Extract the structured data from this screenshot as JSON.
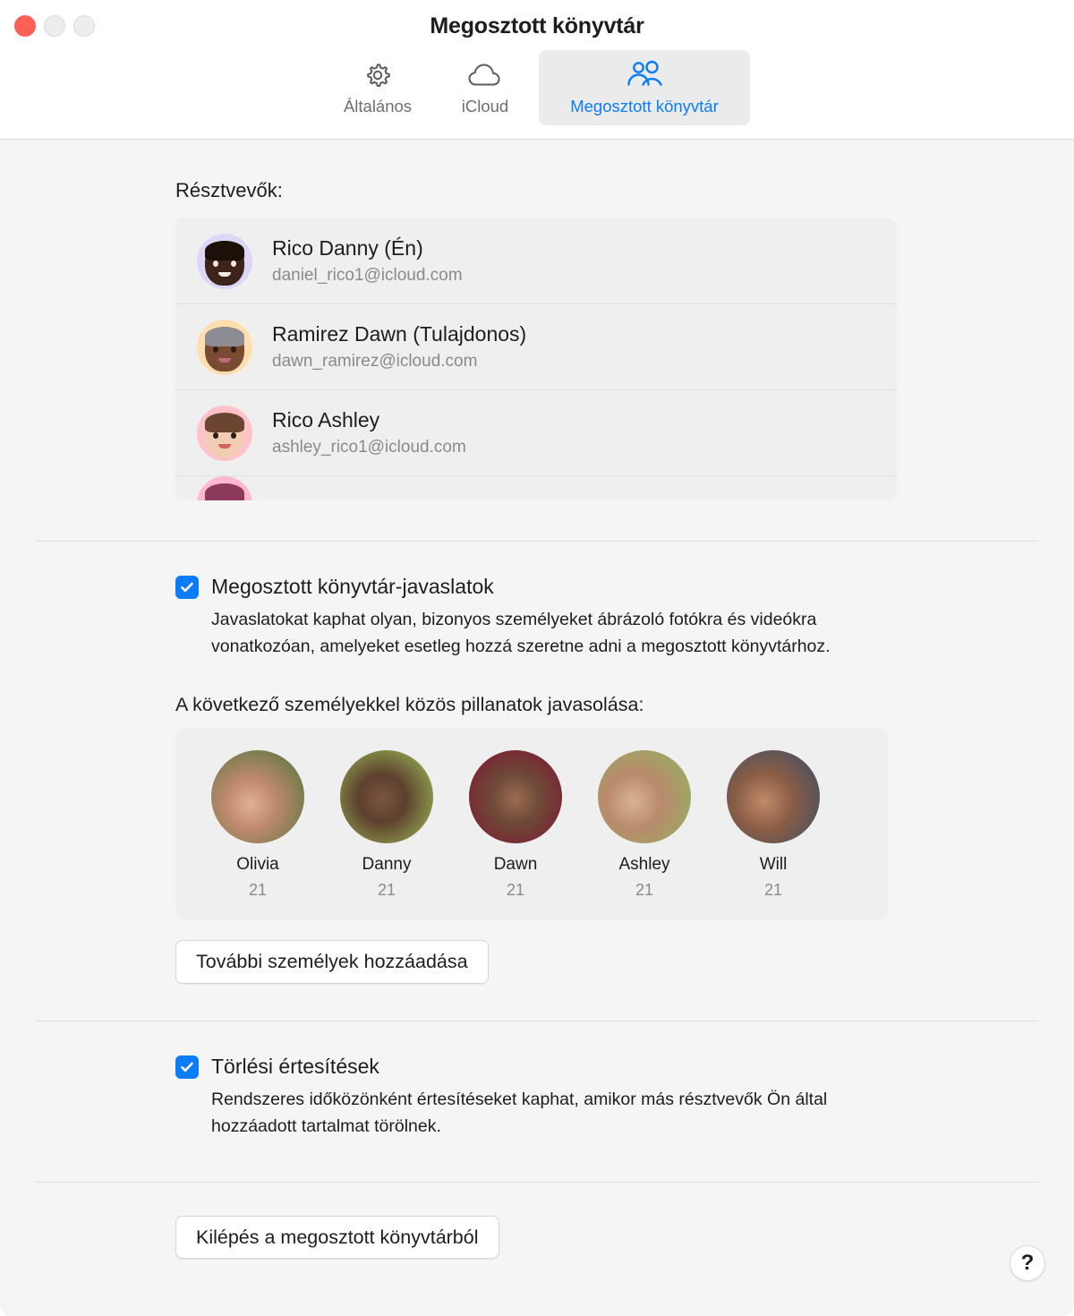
{
  "window": {
    "title": "Megosztott könyvtár",
    "traffic_lights": [
      "close",
      "minimize",
      "zoom"
    ]
  },
  "tabs": [
    {
      "id": "general",
      "label": "Általános",
      "icon": "gear-icon",
      "active": false
    },
    {
      "id": "icloud",
      "label": "iCloud",
      "icon": "cloud-icon",
      "active": false
    },
    {
      "id": "shared-library",
      "label": "Megosztott könyvtár",
      "icon": "people-icon",
      "active": true
    }
  ],
  "participants": {
    "heading": "Résztvevők:",
    "rows": [
      {
        "name": "Rico Danny (Én)",
        "email": "daniel_rico1@icloud.com",
        "avatar_bg": "#ded6f7",
        "skin": "#3c241a",
        "hair": "#1d1009"
      },
      {
        "name": "Ramirez Dawn (Tulajdonos)",
        "email": "dawn_ramirez@icloud.com",
        "avatar_bg": "#ffdfae",
        "skin": "#7a4a33",
        "hair": "#8c8c93"
      },
      {
        "name": "Rico Ashley",
        "email": "ashley_rico1@icloud.com",
        "avatar_bg": "#ffc2cb",
        "skin": "#f0cdb4",
        "hair": "#6b4530"
      },
      {
        "name": "",
        "email": "",
        "avatar_bg": "#ffb8d0",
        "skin": "#a04a70",
        "hair": "#8c3a5c"
      }
    ]
  },
  "suggestions_setting": {
    "label": "Megosztott könyvtár-javaslatok",
    "checked": true,
    "description": "Javaslatokat kaphat olyan, bizonyos személyeket ábrázoló fotókra és videókra vonatkozóan, amelyeket esetleg hozzá szeretne adni a megosztott könyvtárhoz."
  },
  "people_section": {
    "heading": "A következő személyekkel közös pillanatok javasolása:",
    "people": [
      {
        "name": "Olivia",
        "count": "21",
        "c1": "#6f7a4a",
        "c2": "#c89a84",
        "c3": "#f0d6c0"
      },
      {
        "name": "Danny",
        "count": "21",
        "c1": "#8ea04f",
        "c2": "#6b4a33",
        "c3": "#a4512f"
      },
      {
        "name": "Dawn",
        "count": "21",
        "c1": "#7b2233",
        "c2": "#8a5a44",
        "c3": "#2d4468"
      },
      {
        "name": "Ashley",
        "count": "21",
        "c1": "#9aab63",
        "c2": "#c9a88d",
        "c3": "#e8e3d8"
      },
      {
        "name": "Will",
        "count": "21",
        "c1": "#4a5060",
        "c2": "#a97a5e",
        "c3": "#b9bcc0"
      }
    ],
    "add_button": "További személyek hozzáadása"
  },
  "deletion_setting": {
    "label": "Törlési értesítések",
    "checked": true,
    "description": "Rendszeres időközönként értesítéseket kaphat, amikor más résztvevők Ön által hozzáadott tartalmat törölnek."
  },
  "footer": {
    "leave_button": "Kilépés a megosztott könyvtárból",
    "help_symbol": "?"
  },
  "colors": {
    "accent": "#0a7cff",
    "toolbar_bg": "#ffffff",
    "content_bg": "#f5f5f5",
    "group_bg": "#efefef",
    "close_red": "#ff5f57"
  }
}
